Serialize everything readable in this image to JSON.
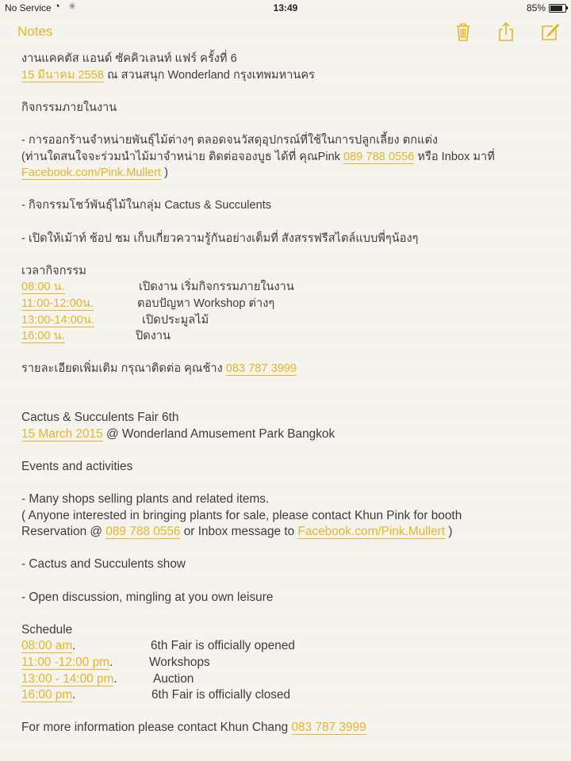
{
  "status_bar": {
    "carrier": "No Service",
    "time": "13:49",
    "battery": "85%"
  },
  "nav": {
    "back_label": "Notes"
  },
  "note": {
    "th": {
      "title": "งานแคคตัส แอนด์ ซัคคิวเลนท์ แฟร์ ครั้งที่ 6",
      "date": "15 มีนาคม 2558",
      "venue": " ณ สวนสนุก Wonderland กรุงเทพมหานคร",
      "activities_heading": "กิจกรรมภายในงาน",
      "item1": "- การออกร้านจำหน่ายพันธุ์ไม้ต่างๆ ตลอดจนวัสดุอุปกรณ์ที่ใช้ในการปลูกเลี้ยง ตกแต่ง",
      "item1_sub_a": "(ท่านใดสนใจจะร่วมนำไม้มาจำหน่าย ติดต่อจองบูธ ได้ที่ คุณPink ",
      "phone_pink": "089 788 0556",
      "item1_sub_b": " หรือ Inbox มาที่",
      "facebook": "Facebook.com/Pink.Mullert",
      "close_paren": " )",
      "item2": "- กิจกรรมโชว์พันธุ์ไม้ในกลุ่ม Cactus & Succulents",
      "item3": "- เปิดให้เม้าท์ ช้อป ชม เก็บเกี่ยวความรู้กันอย่างเต็มที่ สังสรรฟรีสไตล์แบบพี่ๆน้องๆ",
      "schedule_heading": "เวลากิจกรรม",
      "schedule": [
        {
          "time": "08:00 น.",
          "desc": "เปิดงาน เริ่มกิจกรรมภายในงาน"
        },
        {
          "time": "11:00-12:00น.",
          "desc": "ตอบปัญหา Workshop ต่างๆ"
        },
        {
          "time": "13:00-14:00น.",
          "desc": "เปิดประมูลไม้"
        },
        {
          "time": "16:00 น.",
          "desc": "ปิดงาน"
        }
      ],
      "contact": "รายละเอียดเพิ่มเติม กรุณาติดต่อ คุณช้าง ",
      "phone_chang": "083 787 3999"
    },
    "en": {
      "title": "Cactus & Succulents Fair 6th",
      "date": "15 March 2015",
      "venue": " @ Wonderland Amusement Park Bangkok",
      "activities_heading": "Events and activities",
      "item1": "- Many shops selling plants and related items.",
      "item1_sub": "( Anyone interested in bringing plants for sale, please contact Khun Pink for booth",
      "reservation": "Reservation @ ",
      "phone_pink": "089 788 0556",
      "inbox": " or Inbox message to ",
      "facebook": "Facebook.com/Pink.Mullert",
      "close_paren": " )",
      "item2": "- Cactus and Succulents show",
      "item3": "- Open discussion, mingling at you own leisure",
      "schedule_heading": "Schedule",
      "schedule": [
        {
          "time": "08:00 am",
          "desc": "6th Fair is officially opened"
        },
        {
          "time": "11:00 -12:00 pm",
          "desc": "Workshops"
        },
        {
          "time": "13:00 - 14:00 pm",
          "desc": "Auction"
        },
        {
          "time": "16:00 pm",
          "desc": "6th Fair is officially closed"
        }
      ],
      "contact": "For more information please contact Khun Chang ",
      "phone_chang": "083 787 3999"
    }
  },
  "colors": {
    "accent": "#e7b528",
    "text": "#3c3c3c",
    "paper": "#f6f5f0"
  },
  "icons": [
    "trash-icon",
    "share-icon",
    "compose-icon",
    "wifi-icon",
    "battery-icon"
  ]
}
